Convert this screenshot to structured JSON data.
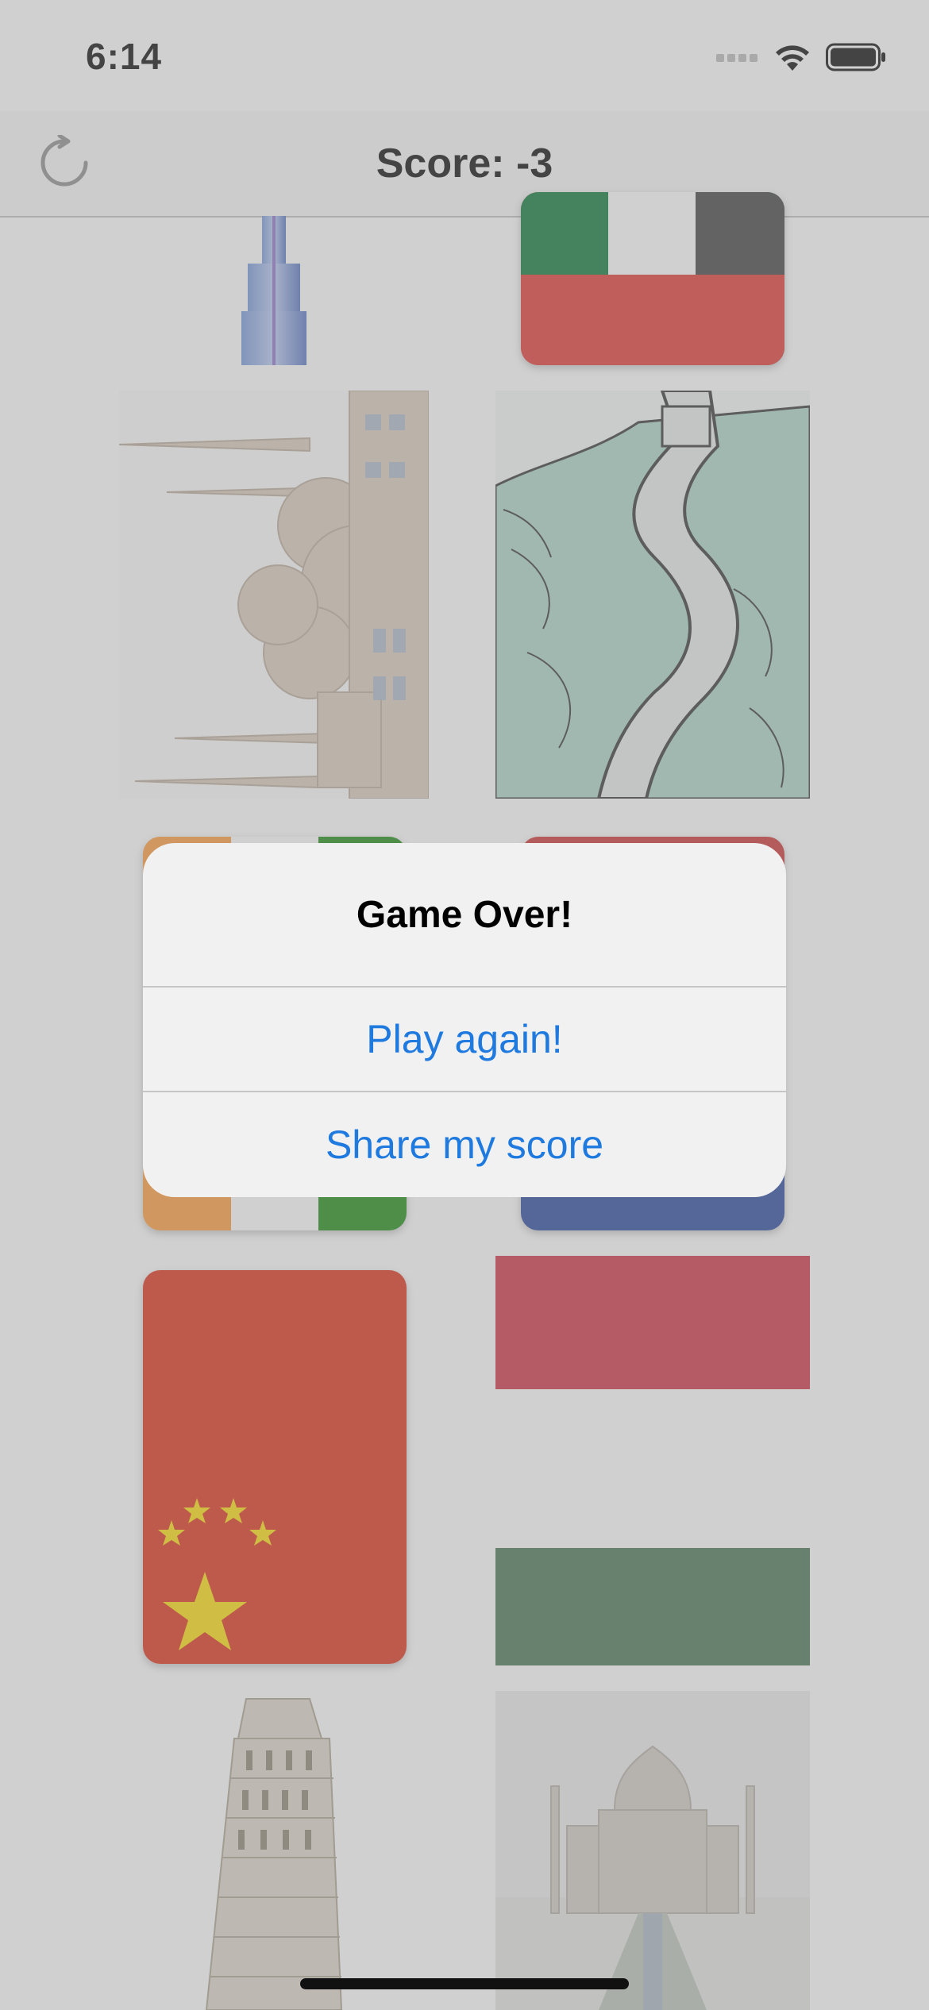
{
  "status_bar": {
    "time": "6:14"
  },
  "nav": {
    "title": "Score: -3",
    "refresh_icon": "refresh-icon"
  },
  "cards": [
    {
      "name": "burj-khalifa-card",
      "kind": "landmark"
    },
    {
      "name": "uae-flag-card",
      "kind": "flag"
    },
    {
      "name": "mosque-card",
      "kind": "landmark"
    },
    {
      "name": "great-wall-card",
      "kind": "landmark"
    },
    {
      "name": "india-flag-card",
      "kind": "flag"
    },
    {
      "name": "flag-card",
      "kind": "flag"
    },
    {
      "name": "china-flag-card",
      "kind": "flag"
    },
    {
      "name": "hungary-flag-card",
      "kind": "flag"
    },
    {
      "name": "leaning-tower-card",
      "kind": "landmark"
    },
    {
      "name": "taj-mahal-card",
      "kind": "landmark"
    }
  ],
  "alert": {
    "title": "Game Over!",
    "buttons": [
      "Play again!",
      "Share my score"
    ]
  },
  "colors": {
    "accent": "#1f7ae0",
    "overlay": "#969696",
    "alert_bg": "#f1f1f2"
  }
}
